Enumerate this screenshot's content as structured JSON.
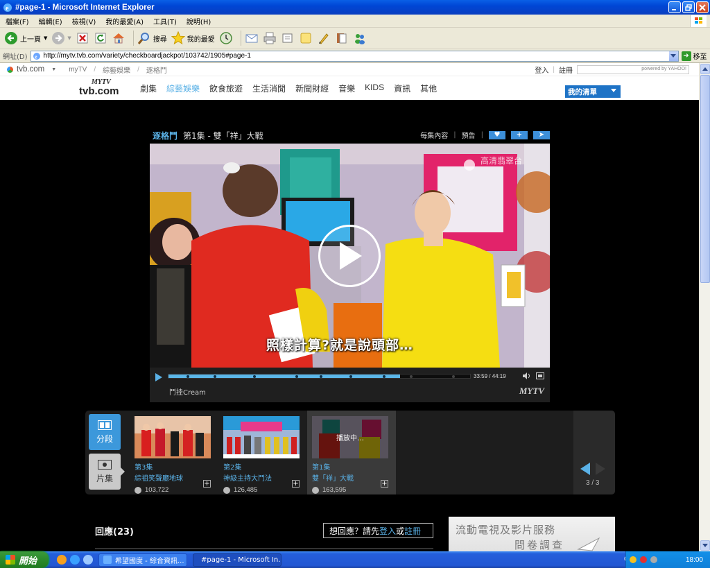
{
  "window": {
    "title": "#page-1 - Microsoft Internet Explorer"
  },
  "menu": {
    "items": [
      "檔案(F)",
      "編輯(E)",
      "檢視(V)",
      "我的最愛(A)",
      "工具(T)",
      "說明(H)"
    ]
  },
  "toolbar": {
    "back_label": "上一頁",
    "search_label": "搜尋",
    "favorites_label": "我的最愛"
  },
  "address": {
    "label": "網址(D)",
    "url": "http://mytv.tvb.com/variety/checkboardjackpot/103742/1905#page-1",
    "go_label": "移至"
  },
  "site": {
    "brand_small": "tvb.com",
    "breadcrumbs": [
      "myTV",
      "綜藝娛樂",
      "逐格鬥"
    ],
    "login_label": "登入",
    "register_label": "註冊",
    "search_powered": "powered by YAHOO!",
    "logo_top": "MYTV",
    "logo_text": "tvb.com",
    "nav": [
      "劇集",
      "綜藝娛樂",
      "飲食旅遊",
      "生活消閒",
      "新聞財經",
      "音樂",
      "KIDS",
      "資訊",
      "其他"
    ],
    "nav_active_index": 1,
    "my_list_label": "我的清單",
    "accent_color": "#5ab1e6"
  },
  "video": {
    "program": "逐格鬥",
    "episode_title": "第1集 - 雙「祥」大戰",
    "link_episodes": "每集內容",
    "link_trailer": "預告",
    "subtitle": "照樣計算?就是說頭部…",
    "watermark": "高清翡翠台",
    "time_label": "33:59 / 44:19",
    "progress_fraction": 0.767,
    "sponsor": "鬥挂Cream",
    "logo": "MYTV"
  },
  "carousel": {
    "segment_label": "分段",
    "episodes_label": "片集",
    "cards": [
      {
        "no": "第3集",
        "name": "綜祖笑聲廳地球",
        "views": "103,722",
        "playing": false
      },
      {
        "no": "第2集",
        "name": "神級主持大鬥法",
        "views": "126,485",
        "playing": false
      },
      {
        "no": "第1集",
        "name": "雙「祥」大戰",
        "views": "163,595",
        "playing": true,
        "playing_label": "播放中…"
      }
    ],
    "page_label": "3 / 3"
  },
  "comments": {
    "title": "回應(23)",
    "reply_prefix": "想回應？請先",
    "login_link": "登入",
    "or": "或",
    "register_link": "註冊"
  },
  "ad": {
    "line1": "流動電視及影片服務",
    "line2": "問卷調查"
  },
  "taskbar": {
    "start_label": "開始",
    "tasks": [
      "希望國度 - 綜合資訊...",
      "#page-1 - Microsoft In..."
    ],
    "lang": "CH",
    "clock": "18:00"
  }
}
